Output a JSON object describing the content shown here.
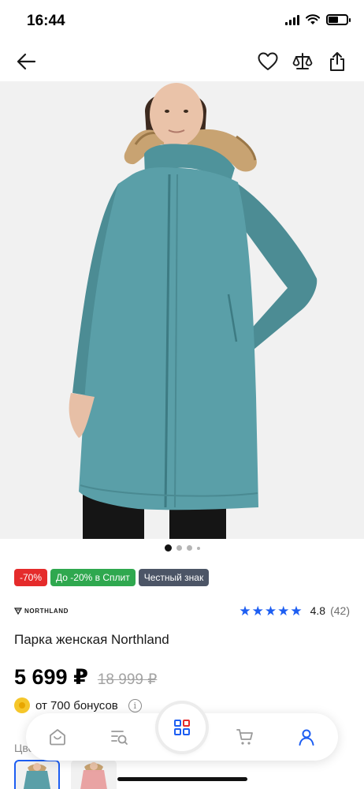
{
  "status_bar": {
    "time": "16:44"
  },
  "nav": {
    "icons": [
      "back-arrow-icon",
      "heart-icon",
      "compare-icon",
      "share-icon"
    ]
  },
  "gallery": {
    "image": "woman in teal parka with fur hood",
    "dots_total": 4,
    "active_index": 0
  },
  "badges": [
    {
      "label": "-70%",
      "color": "#e52b2b"
    },
    {
      "label": "До -20% в Сплит",
      "color": "#2fa84f"
    },
    {
      "label": "Честный знак",
      "color": "#4c5566"
    }
  ],
  "product": {
    "brand": "NORTHLAND",
    "title": "Парка женская Northland",
    "rating": {
      "value": "4.8",
      "count": "(42)",
      "stars": 5
    },
    "price": {
      "current": "5 699 ₽",
      "old": "18 999 ₽"
    },
    "bonus": {
      "text": "от 700 бонусов",
      "info_icon": "i"
    },
    "color_label": "Цвет",
    "color_options": [
      "teal",
      "pink"
    ]
  },
  "tab_bar": {
    "items": [
      "home-icon",
      "catalog-search-icon",
      "menu-grid-icon",
      "cart-icon",
      "profile-icon"
    ],
    "active": "profile-icon"
  },
  "colors": {
    "accent": "#1d5ef2",
    "parka_teal": "#5a9fa8",
    "price_text": "#000000"
  }
}
